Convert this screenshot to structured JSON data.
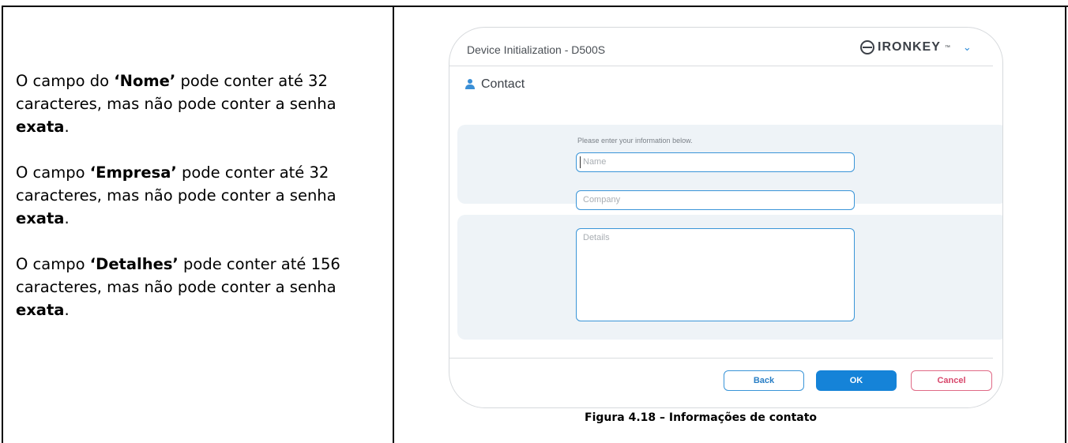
{
  "left_text": {
    "p1": {
      "a": "O campo do ",
      "b": "‘Nome’",
      "c": " pode conter até 32 caracteres, mas não pode conter a senha ",
      "d": "exata",
      "e": "."
    },
    "p2": {
      "a": "O campo ",
      "b": "‘Empresa’",
      "c": " pode conter até 32 caracteres, mas não pode conter a senha ",
      "d": "exata",
      "e": "."
    },
    "p3": {
      "a": "O campo ",
      "b": "‘Detalhes’",
      "c": " pode conter até 156 caracteres, mas não pode conter a senha ",
      "d": "exata",
      "e": "."
    }
  },
  "dialog": {
    "title": "Device Initialization - D500S",
    "brand": "IRONKEY",
    "brand_tm": "™",
    "menu_chevron": "⌄",
    "section_title": "Contact",
    "hint": "Please enter your information below.",
    "name_placeholder": "Name",
    "company_placeholder": "Company",
    "details_placeholder": "Details",
    "buttons": {
      "back": "Back",
      "ok": "OK",
      "cancel": "Cancel"
    }
  },
  "caption": "Figura 4.18 – Informações de contato",
  "colors": {
    "accent": "#1583d8",
    "cancel": "#d8476b",
    "panel": "#eef3f7"
  },
  "icons": [
    "ironkey-logo-icon",
    "person-icon",
    "chevron-down-icon"
  ]
}
